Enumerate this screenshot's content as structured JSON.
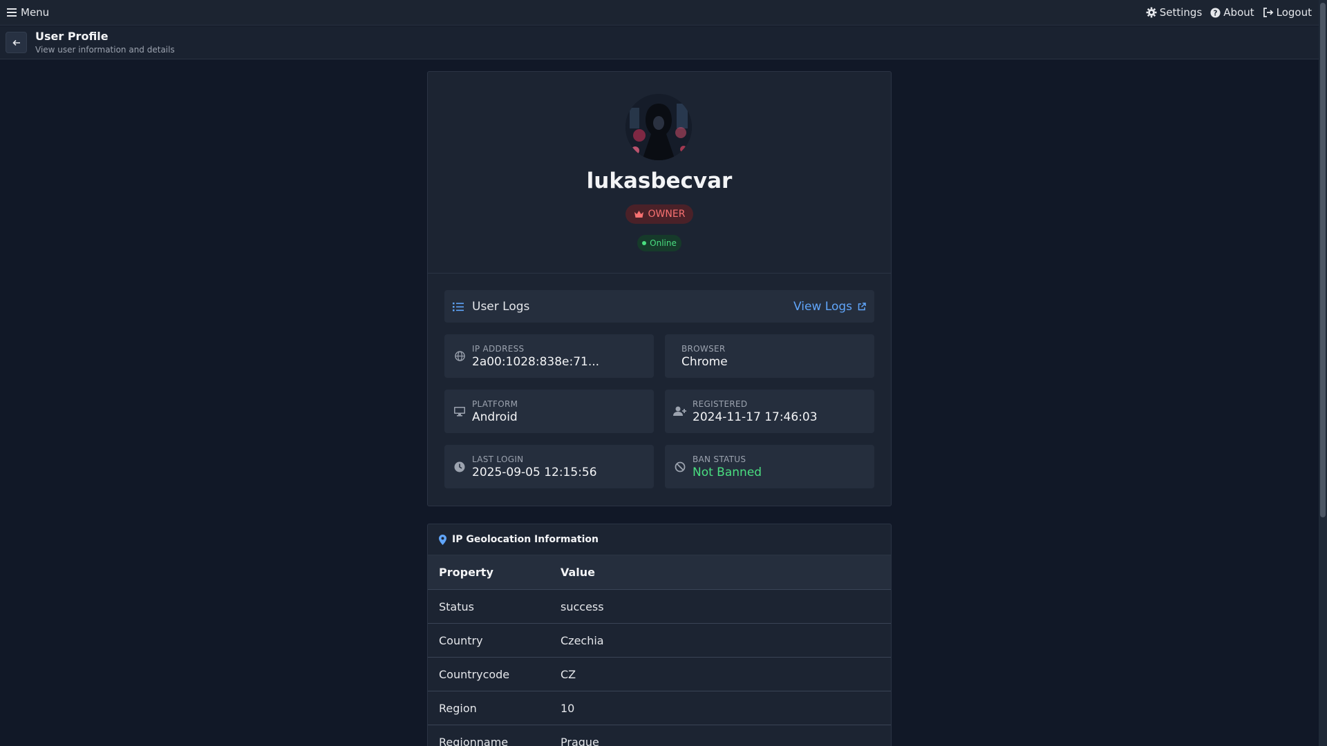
{
  "navbar": {
    "menu_label": "Menu",
    "settings_label": "Settings",
    "about_label": "About",
    "logout_label": "Logout"
  },
  "header": {
    "title": "User Profile",
    "subtitle": "View user information and details"
  },
  "profile": {
    "username": "lukasbecvar",
    "role": "OWNER",
    "status": "Online"
  },
  "logs": {
    "title": "User Logs",
    "view_logs_label": "View Logs"
  },
  "info": {
    "ip_address_label": "IP ADDRESS",
    "ip_address": "2a00:1028:838e:71...",
    "browser_label": "BROWSER",
    "browser": "Chrome",
    "platform_label": "PLATFORM",
    "platform": "Android",
    "registered_label": "REGISTERED",
    "registered": "2024-11-17 17:46:03",
    "last_login_label": "LAST LOGIN",
    "last_login": "2025-09-05 12:15:56",
    "ban_status_label": "BAN STATUS",
    "ban_status": "Not Banned"
  },
  "geo": {
    "title": "IP Geolocation Information",
    "headers": [
      "Property",
      "Value"
    ],
    "rows": [
      [
        "Status",
        "success"
      ],
      [
        "Country",
        "Czechia"
      ],
      [
        "Countrycode",
        "CZ"
      ],
      [
        "Region",
        "10"
      ],
      [
        "Regionname",
        "Prague"
      ]
    ]
  },
  "colors": {
    "background": "#111827",
    "accent": "#60a5fa",
    "owner": "#f87171",
    "online": "#4ade80"
  }
}
